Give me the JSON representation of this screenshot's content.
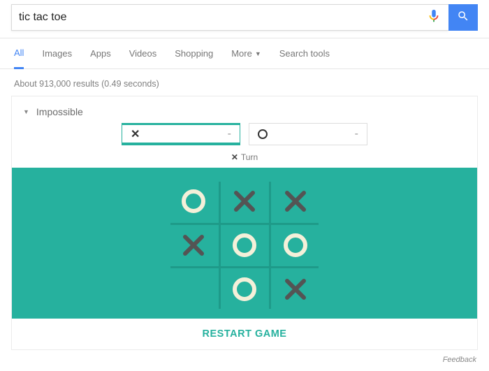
{
  "search": {
    "query": "tic tac toe"
  },
  "tabs": {
    "all": "All",
    "images": "Images",
    "apps": "Apps",
    "videos": "Videos",
    "shopping": "Shopping",
    "more": "More",
    "searchtools": "Search tools"
  },
  "results_meta": "About 913,000 results (0.49 seconds)",
  "game": {
    "difficulty": "Impossible",
    "scores": {
      "x": "-",
      "o": "-"
    },
    "turn_mark": "✕",
    "turn_label": "Turn",
    "restart": "RESTART GAME",
    "board": [
      [
        "O",
        "X",
        "X"
      ],
      [
        "X",
        "O",
        "O"
      ],
      [
        "",
        "O",
        "X"
      ]
    ]
  },
  "feedback": "Feedback",
  "colors": {
    "teal": "#26b19e",
    "blue": "#4285f4"
  }
}
